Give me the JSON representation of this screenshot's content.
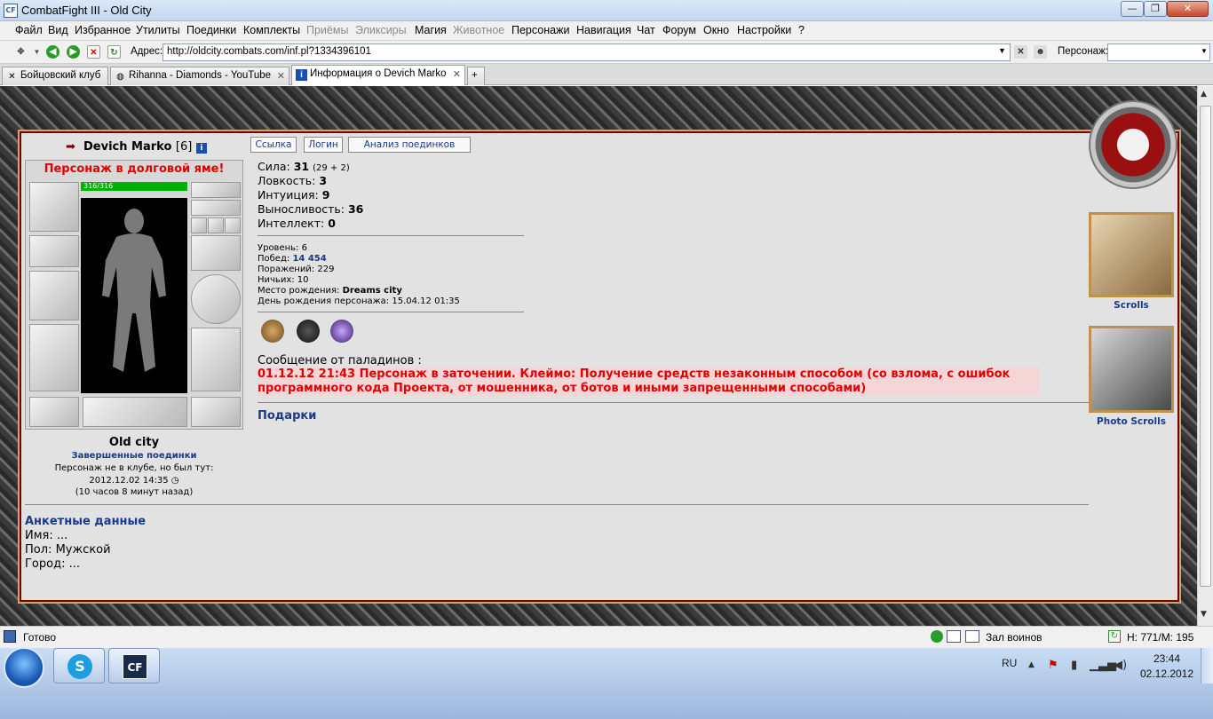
{
  "window": {
    "title": "CombatFight III - Old City",
    "app_icon": "CF",
    "min": "—",
    "max": "❐",
    "close": "✕"
  },
  "menu": [
    "Файл",
    "Вид",
    "Избранное",
    "Утилиты",
    "Поединки",
    "Комплекты",
    "Приёмы",
    "Эликсиры",
    "Магия",
    "Животное",
    "Персонажи",
    "Навигация",
    "Чат",
    "Форум",
    "Окно",
    "Настройки",
    "?"
  ],
  "menu_disabled": [
    "Приёмы",
    "Эликсиры",
    "Животное"
  ],
  "addressbar": {
    "label": "Адрес:",
    "url": "http://oldcity.combats.com/inf.pl?1334396101",
    "char_label": "Персонаж:",
    "char_value": ""
  },
  "tabs": [
    {
      "label": "Бойцовский клуб",
      "icon": "crossed-swords-icon"
    },
    {
      "label": "Rihanna - Diamonds - YouTube",
      "icon": "globe-icon"
    },
    {
      "label": "Информация о Devich Marko",
      "icon": "info-icon"
    }
  ],
  "player": {
    "name": "Devich Marko",
    "level_badge": "[6]",
    "debt_notice": "Персонаж в долговой яме!",
    "hp": "316/316",
    "hp_fraction": 1.0
  },
  "player_buttons": {
    "link": "Ссылка",
    "login": "Логин",
    "battle_analysis": "Анализ поединков"
  },
  "stats": {
    "strength_label": "Сила:",
    "strength_value": "31",
    "strength_extra": "(29 + 2)",
    "agility_label": "Ловкость:",
    "agility_value": "3",
    "intuition_label": "Интуиция:",
    "intuition_value": "9",
    "endurance_label": "Выносливость:",
    "endurance_value": "36",
    "intellect_label": "Интеллект:",
    "intellect_value": "0"
  },
  "info": {
    "level_label": "Уровень:",
    "level_value": "6",
    "wins_label": "Побед:",
    "wins_value": "14 454",
    "losses_label": "Поражений:",
    "losses_value": "229",
    "draws_label": "Ничьих:",
    "draws_value": "10",
    "birthplace_label": "Место рождения:",
    "birthplace_value": "Dreams city",
    "birthday_label": "День рождения персонажа:",
    "birthday_value": "15.04.12 01:35"
  },
  "paladin": {
    "title": "Сообщение от паладинов :",
    "line1": "01.12.12 21:43 Персонаж в заточении. Клеймо: Получение средств незаконным способом (со взлома, с ошибок",
    "line2": "программного кода Проекта, от мошенника, от ботов и иными запрещенными способами)"
  },
  "gifts_label": "Подарки",
  "location": {
    "city": "Old city",
    "finished_battles": "Завершенные поединки",
    "club_status": "Персонаж не в клубе, но был тут:",
    "last_seen": "2012.12.02 14:35",
    "ago": "(10 часов 8 минут назад)"
  },
  "profile": {
    "title": "Анкетные данные",
    "name_label": "Имя:",
    "name_value": "...",
    "gender_label": "Пол:",
    "gender_value": "Мужской",
    "city_label": "Город:",
    "city_value": "..."
  },
  "side": {
    "scrolls": "Scrolls",
    "photo_scrolls": "Photo Scrolls"
  },
  "status": {
    "text": "Готово",
    "zone": "Зал воинов",
    "hm": "H: 771/M: 195"
  },
  "taskbar": {
    "lang": "RU",
    "time": "23:44",
    "date": "02.12.2012"
  },
  "colors": {
    "accent_red": "#e00000",
    "link_blue": "#1a3a8a",
    "panel_bg": "#e2e2e2",
    "hp_green": "#00b000"
  }
}
